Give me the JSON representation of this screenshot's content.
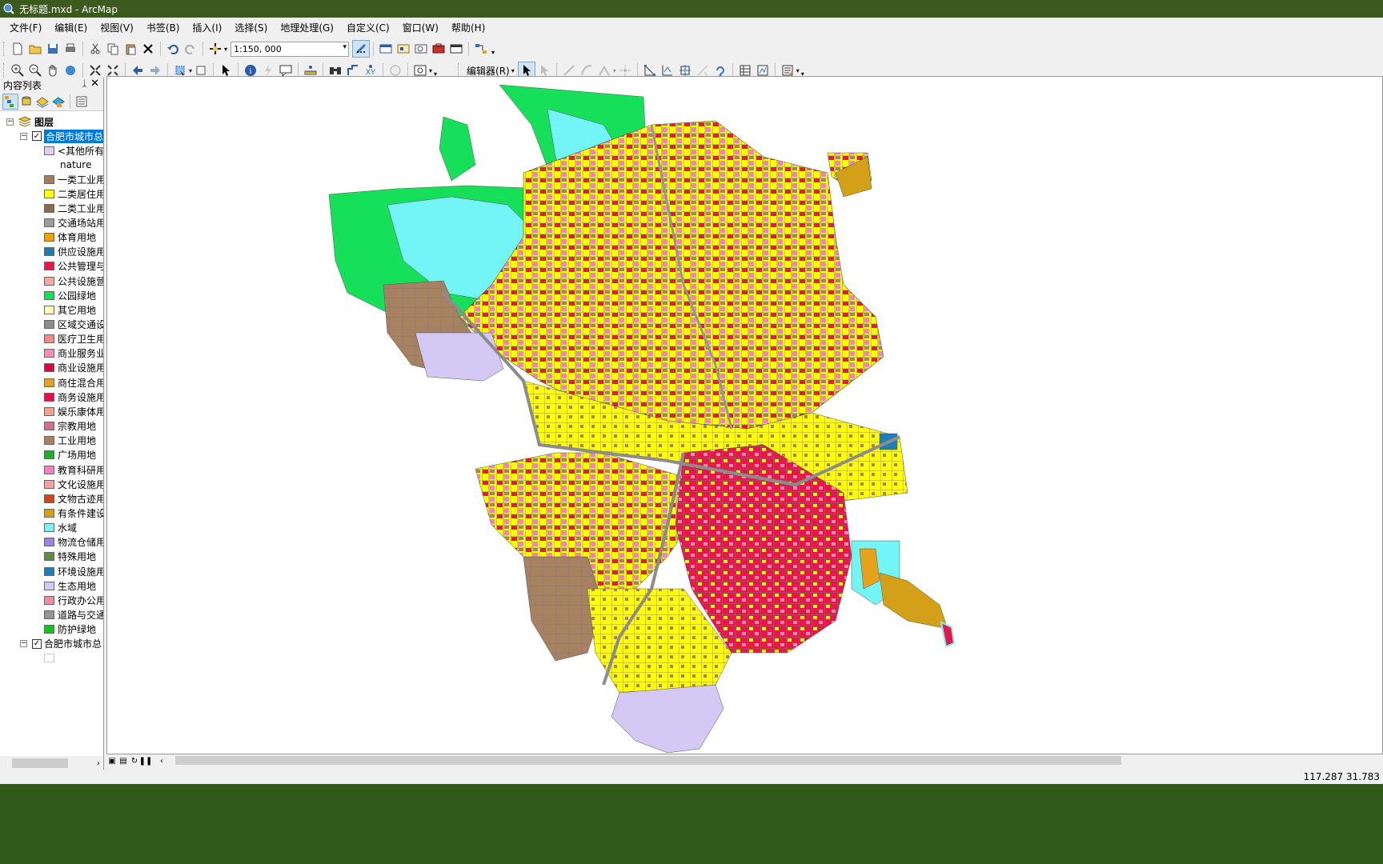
{
  "window": {
    "title": "无标题.mxd - ArcMap"
  },
  "menu": [
    "文件(F)",
    "编辑(E)",
    "视图(V)",
    "书签(B)",
    "插入(I)",
    "选择(S)",
    "地理处理(G)",
    "自定义(C)",
    "窗口(W)",
    "帮助(H)"
  ],
  "toolbar": {
    "scale_value": "1:150, 000",
    "editor_label": "编辑器(R)"
  },
  "toc": {
    "title": "内容列表",
    "root_label": "图层",
    "layer1_label": "合肥市城市总",
    "layer1_checked": true,
    "other_values_label": "<其他所有值",
    "field_label": "nature",
    "legend": [
      {
        "label": "一类工业用",
        "color": "#a47c5e"
      },
      {
        "label": "二类居住用",
        "color": "#ffff00"
      },
      {
        "label": "二类工业用",
        "color": "#8b6b4a"
      },
      {
        "label": "交通场站用",
        "color": "#9c9c9c"
      },
      {
        "label": "体育用地",
        "color": "#f5a000"
      },
      {
        "label": "供应设施用",
        "color": "#1a7fa8"
      },
      {
        "label": "公共管理与",
        "color": "#e8174a"
      },
      {
        "label": "公共设施营",
        "color": "#f7a8a0"
      },
      {
        "label": "公园绿地",
        "color": "#16e05a"
      },
      {
        "label": "其它用地",
        "color": "#fcfcb4"
      },
      {
        "label": "区域交通设",
        "color": "#8c8c8c"
      },
      {
        "label": "医疗卫生用",
        "color": "#f28a8a"
      },
      {
        "label": "商业服务业",
        "color": "#f58fb3"
      },
      {
        "label": "商业设施用",
        "color": "#e6003c"
      },
      {
        "label": "商住混合用",
        "color": "#e6a21a"
      },
      {
        "label": "商务设施用",
        "color": "#e8104a"
      },
      {
        "label": "娱乐康体用",
        "color": "#f5a08a"
      },
      {
        "label": "宗教用地",
        "color": "#d0708a"
      },
      {
        "label": "工业用地",
        "color": "#a88260"
      },
      {
        "label": "广场用地",
        "color": "#1fae2a"
      },
      {
        "label": "教育科研用",
        "color": "#f47fc2"
      },
      {
        "label": "文化设施用",
        "color": "#f5a0a0"
      },
      {
        "label": "文物古迹用",
        "color": "#d8401a"
      },
      {
        "label": "有条件建设",
        "color": "#d4a017"
      },
      {
        "label": "水域",
        "color": "#73f5f5"
      },
      {
        "label": "物流仓储用",
        "color": "#9b82e8"
      },
      {
        "label": "特殊用地",
        "color": "#5e8c46"
      },
      {
        "label": "环境设施用",
        "color": "#1e7fb8"
      },
      {
        "label": "生态用地",
        "color": "#d4c8f5"
      },
      {
        "label": "行政办公用",
        "color": "#f08ca0"
      },
      {
        "label": "道路与交通",
        "color": "#969696"
      },
      {
        "label": "防护绿地",
        "color": "#12c31a"
      }
    ],
    "layer2_label": "合肥市城市总",
    "layer2_checked": true
  },
  "status": {
    "coordinates": "117.287  31.783"
  }
}
